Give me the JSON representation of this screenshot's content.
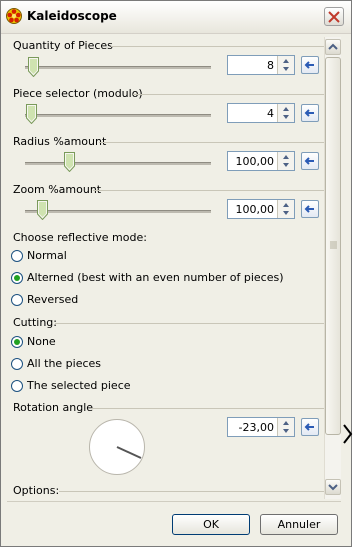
{
  "window": {
    "title": "Kaleidoscope",
    "close_icon": "close-icon"
  },
  "colors": {
    "accent": "#316ac5",
    "radio_dot": "#21a121",
    "panel_bg": "#f0efe6"
  },
  "quantity": {
    "label": "Quantity of Pieces",
    "value": "8"
  },
  "piece_selector": {
    "label": "Piece selector (modulo)",
    "value": "4"
  },
  "radius": {
    "label": "Radius %amount",
    "value": "100,00"
  },
  "zoom": {
    "label": "Zoom %amount",
    "value": "100,00"
  },
  "reflective": {
    "label": "Choose reflective mode:",
    "options": [
      "Normal",
      "Alterned (best with an even number of pieces)",
      "Reversed"
    ],
    "selected": "Alterned (best with an even number of pieces)"
  },
  "cutting": {
    "label": "Cutting:",
    "options": [
      "None",
      "All the pieces",
      "The selected piece"
    ],
    "selected": "None"
  },
  "rotation": {
    "label": "Rotation angle",
    "value": "-23,00"
  },
  "options_label": "Options:",
  "buttons": {
    "ok": "OK",
    "cancel": "Annuler"
  }
}
